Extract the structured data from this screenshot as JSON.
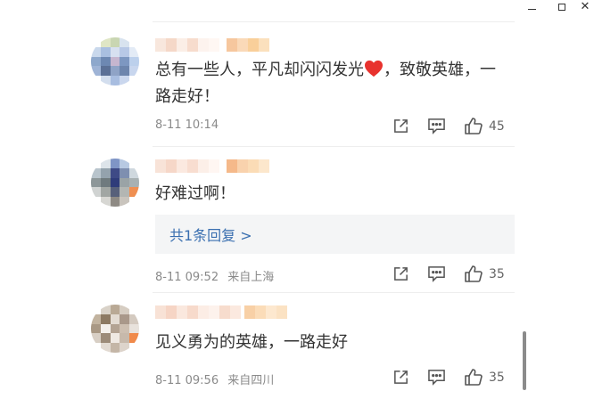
{
  "comments": [
    {
      "text_before_emoji": "总有一些人，平凡却闪闪发光",
      "emoji": "heart-emoji",
      "text_after_emoji": "，致敬英雄，一路走好！",
      "time": "8-11 10:14",
      "location": "",
      "likes": "45"
    },
    {
      "text": "好难过啊！",
      "reply_summary": "共1条回复 >",
      "time": "8-11 09:52",
      "location": "来自上海",
      "likes": "35"
    },
    {
      "text": "见义勇为的英雄，一路走好",
      "time": "8-11 09:56",
      "location": "来自四川",
      "likes": "35"
    }
  ],
  "icons": {
    "share": "share-icon",
    "comment": "comment-icon",
    "like": "thumbs-up-icon",
    "minimize": "minimize-icon",
    "maximize": "maximize-icon",
    "close": "close-icon"
  },
  "window": {
    "close_glyph": "✕"
  },
  "colors": {
    "text": "#333333",
    "meta": "#8a8a8a",
    "link": "#3a6fb0",
    "reply_bg": "#f4f5f6",
    "heart": "#e8322e"
  }
}
